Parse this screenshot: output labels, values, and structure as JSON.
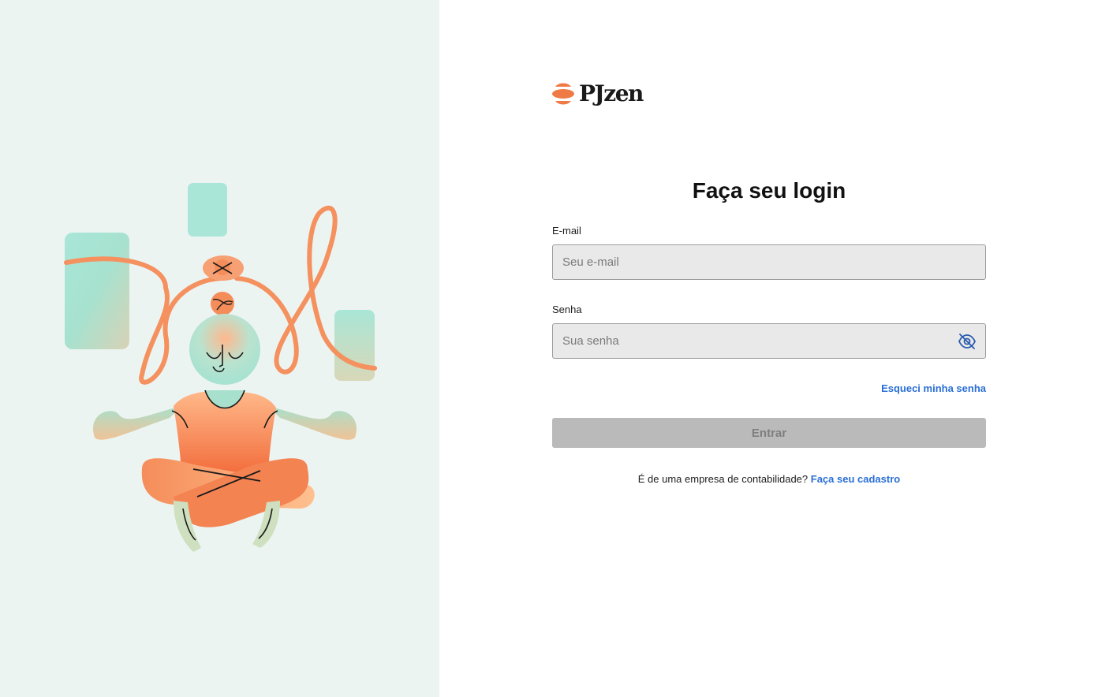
{
  "brand": {
    "name": "PJzen",
    "accent_color": "#f07a45"
  },
  "login": {
    "title": "Faça seu login",
    "email_label": "E-mail",
    "email_placeholder": "Seu e-mail",
    "password_label": "Senha",
    "password_placeholder": "Sua senha",
    "toggle_visibility_icon": "eye-off-icon",
    "forgot_link": "Esqueci minha senha",
    "submit_label": "Entrar",
    "signup_prompt": "É de uma empresa de contabilidade?",
    "signup_link": "Faça seu cadastro",
    "link_color": "#2a6fd6"
  },
  "illustration": {
    "icon": "meditating-person-illustration"
  }
}
